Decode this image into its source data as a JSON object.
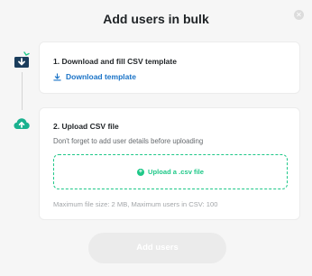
{
  "header": {
    "title": "Add users in bulk",
    "close_icon": "close-icon"
  },
  "steps": [
    {
      "icon": "download-box-icon",
      "title": "1. Download and fill CSV template",
      "link_icon": "download-icon",
      "link_label": "Download template"
    },
    {
      "icon": "cloud-upload-icon",
      "title": "2. Upload CSV file",
      "subtitle": "Don't forget to add user details before uploading",
      "upload_icon": "plus-circle-icon",
      "upload_label": "Upload a .csv file",
      "footnote": "Maximum file size: 2 MB, Maximum users in CSV: 100"
    }
  ],
  "footer": {
    "submit_label": "Add users",
    "submit_enabled": false
  },
  "colors": {
    "accent_green": "#1ec888",
    "link_blue": "#1a73c7",
    "step_one_icon": "#1b3d5c",
    "step_two_icon": "#1ab18f",
    "disabled_button": "#ebebeb"
  }
}
